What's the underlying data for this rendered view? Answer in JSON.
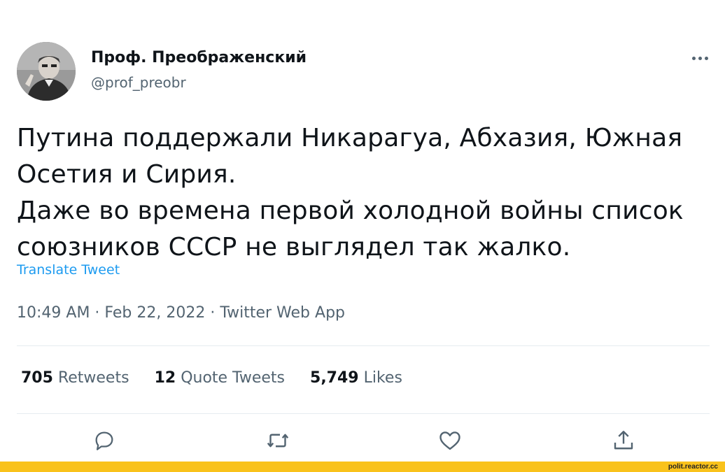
{
  "author": {
    "display_name": "Проф. Преображенский",
    "handle": "@prof_preobr"
  },
  "tweet": {
    "text": "Путина поддержали Никарагуа, Абхазия, Южная\nОсетия и Сирия.\nДаже во времена первой холодной войны список\nсоюзников СССР не выглядел так жалко.",
    "translate_label": "Translate Tweet",
    "time": "10:49 AM",
    "date": "Feb 22, 2022",
    "source": "Twitter Web App",
    "separator": " · "
  },
  "stats": {
    "retweets_count": "705",
    "retweets_label": "Retweets",
    "quotes_count": "12",
    "quotes_label": "Quote Tweets",
    "likes_count": "5,749",
    "likes_label": "Likes"
  },
  "icons": {
    "more": "more-horizontal-icon",
    "reply": "reply-icon",
    "retweet": "retweet-icon",
    "like": "heart-icon",
    "share": "share-icon"
  },
  "colors": {
    "accent": "#1d9bf0",
    "muted": "#536471",
    "footer": "#f9c21b"
  },
  "footer": {
    "site": "polit.reactor.cc"
  }
}
